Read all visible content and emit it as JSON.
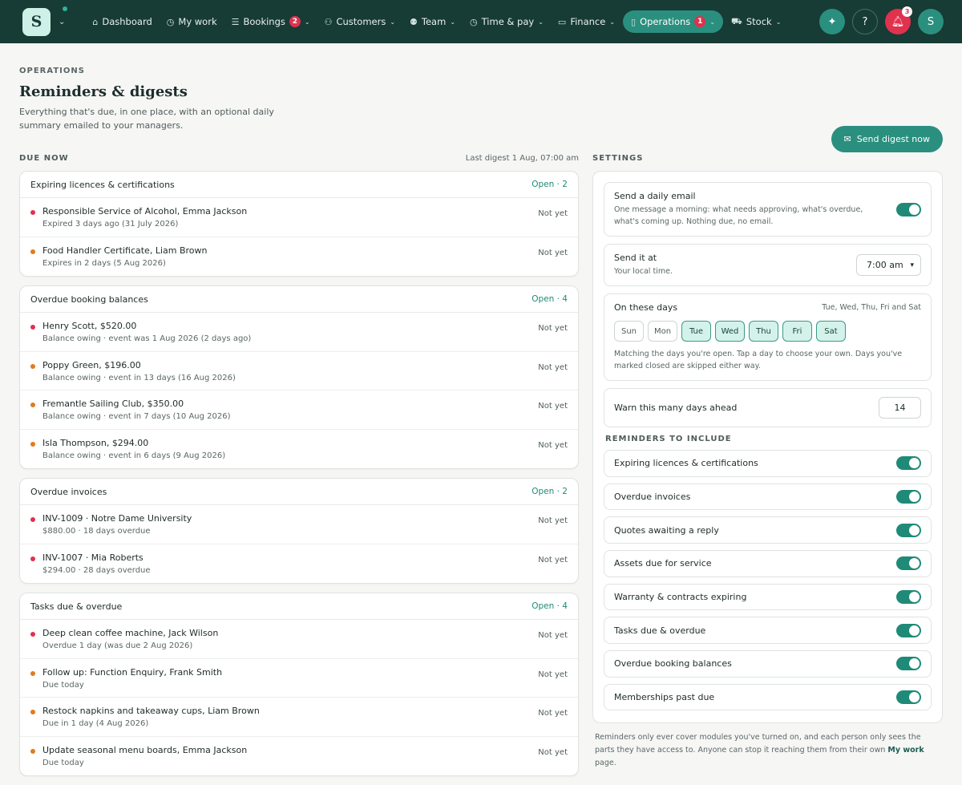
{
  "app": {
    "logo_letter": "S",
    "user_initial": "S"
  },
  "nav": [
    {
      "key": "dashboard",
      "label": "Dashboard",
      "icon": "home-icon",
      "glyph": "⌂",
      "chevron": false,
      "badge": ""
    },
    {
      "key": "my-work",
      "label": "My work",
      "icon": "clock-icon",
      "glyph": "◷",
      "chevron": false,
      "badge": ""
    },
    {
      "key": "bookings",
      "label": "Bookings",
      "icon": "list-icon",
      "glyph": "☰",
      "chevron": true,
      "badge": "2"
    },
    {
      "key": "customers",
      "label": "Customers",
      "icon": "users-icon",
      "glyph": "⚇",
      "chevron": true,
      "badge": ""
    },
    {
      "key": "team",
      "label": "Team",
      "icon": "team-icon",
      "glyph": "⚉",
      "chevron": true,
      "badge": ""
    },
    {
      "key": "time-pay",
      "label": "Time & pay",
      "icon": "clock-icon",
      "glyph": "◷",
      "chevron": true,
      "badge": ""
    },
    {
      "key": "finance",
      "label": "Finance",
      "icon": "card-icon",
      "glyph": "▭",
      "chevron": true,
      "badge": ""
    },
    {
      "key": "operations",
      "label": "Operations",
      "icon": "clipboard-icon",
      "glyph": "▯",
      "chevron": true,
      "badge": "1",
      "active": true
    },
    {
      "key": "stock",
      "label": "Stock",
      "icon": "cart-icon",
      "glyph": "⛟",
      "chevron": true,
      "badge": ""
    }
  ],
  "notifications_count": "3",
  "header": {
    "eyebrow": "OPERATIONS",
    "title": "Reminders & digests",
    "subtitle": "Everything that's due, in one place, with an optional daily summary emailed to your managers.",
    "send_button": "Send digest now"
  },
  "due_now": {
    "title": "DUE NOW",
    "last_digest": "Last digest 1 Aug, 07:00 am",
    "cards": [
      {
        "title": "Expiring licences & certifications",
        "count": "Open · 2",
        "rows": [
          {
            "dot": "red",
            "title": "Responsible Service of Alcohol, Emma Jackson",
            "sub": "Expired 3 days ago (31 July 2026)",
            "status": "Not yet"
          },
          {
            "dot": "orange",
            "title": "Food Handler Certificate, Liam Brown",
            "sub": "Expires in 2 days (5 Aug 2026)",
            "status": "Not yet"
          }
        ]
      },
      {
        "title": "Overdue booking balances",
        "count": "Open · 4",
        "rows": [
          {
            "dot": "red",
            "title": "Henry Scott, $520.00",
            "sub": "Balance owing · event was 1 Aug 2026 (2 days ago)",
            "status": "Not yet"
          },
          {
            "dot": "orange",
            "title": "Poppy Green, $196.00",
            "sub": "Balance owing · event in 13 days (16 Aug 2026)",
            "status": "Not yet"
          },
          {
            "dot": "orange",
            "title": "Fremantle Sailing Club, $350.00",
            "sub": "Balance owing · event in 7 days (10 Aug 2026)",
            "status": "Not yet"
          },
          {
            "dot": "orange",
            "title": "Isla Thompson, $294.00",
            "sub": "Balance owing · event in 6 days (9 Aug 2026)",
            "status": "Not yet"
          }
        ]
      },
      {
        "title": "Overdue invoices",
        "count": "Open · 2",
        "rows": [
          {
            "dot": "red",
            "title": "INV-1009 · Notre Dame University",
            "sub": "$880.00 · 18 days overdue",
            "status": "Not yet"
          },
          {
            "dot": "red",
            "title": "INV-1007 · Mia Roberts",
            "sub": "$294.00 · 28 days overdue",
            "status": "Not yet"
          }
        ]
      },
      {
        "title": "Tasks due & overdue",
        "count": "Open · 4",
        "rows": [
          {
            "dot": "red",
            "title": "Deep clean coffee machine, Jack Wilson",
            "sub": "Overdue 1 day (was due 2 Aug 2026)",
            "status": "Not yet"
          },
          {
            "dot": "orange",
            "title": "Follow up: Function Enquiry, Frank Smith",
            "sub": "Due today",
            "status": "Not yet"
          },
          {
            "dot": "orange",
            "title": "Restock napkins and takeaway cups, Liam Brown",
            "sub": "Due in 1 day (4 Aug 2026)",
            "status": "Not yet"
          },
          {
            "dot": "orange",
            "title": "Update seasonal menu boards, Emma Jackson",
            "sub": "Due today",
            "status": "Not yet"
          }
        ]
      }
    ]
  },
  "settings": {
    "title": "SETTINGS",
    "daily_email": {
      "label": "Send a daily email",
      "hint": "One message a morning: what needs approving, what's overdue, what's coming up. Nothing due, no email.",
      "on": true
    },
    "send_at": {
      "label": "Send it at",
      "hint": "Your local time.",
      "value": "7:00 am"
    },
    "days": {
      "label": "On these days",
      "summary": "Tue, Wed, Thu, Fri and Sat",
      "items": [
        {
          "label": "Sun",
          "on": false
        },
        {
          "label": "Mon",
          "on": false
        },
        {
          "label": "Tue",
          "on": true
        },
        {
          "label": "Wed",
          "on": true
        },
        {
          "label": "Thu",
          "on": true
        },
        {
          "label": "Fri",
          "on": true
        },
        {
          "label": "Sat",
          "on": true
        }
      ],
      "hint": "Matching the days you're open. Tap a day to choose your own. Days you've marked closed are skipped either way."
    },
    "warn_ahead": {
      "label": "Warn this many days ahead",
      "value": "14"
    },
    "reminders_title": "REMINDERS TO INCLUDE",
    "reminders": [
      {
        "label": "Expiring licences & certifications",
        "on": true
      },
      {
        "label": "Overdue invoices",
        "on": true
      },
      {
        "label": "Quotes awaiting a reply",
        "on": true
      },
      {
        "label": "Assets due for service",
        "on": true
      },
      {
        "label": "Warranty & contracts expiring",
        "on": true
      },
      {
        "label": "Tasks due & overdue",
        "on": true
      },
      {
        "label": "Overdue booking balances",
        "on": true
      },
      {
        "label": "Memberships past due",
        "on": true
      }
    ],
    "footnote_before": "Reminders only ever cover modules you've turned on, and each person only sees the parts they have access to. Anyone can stop it reaching them from their own ",
    "footnote_link": "My work",
    "footnote_after": " page."
  }
}
